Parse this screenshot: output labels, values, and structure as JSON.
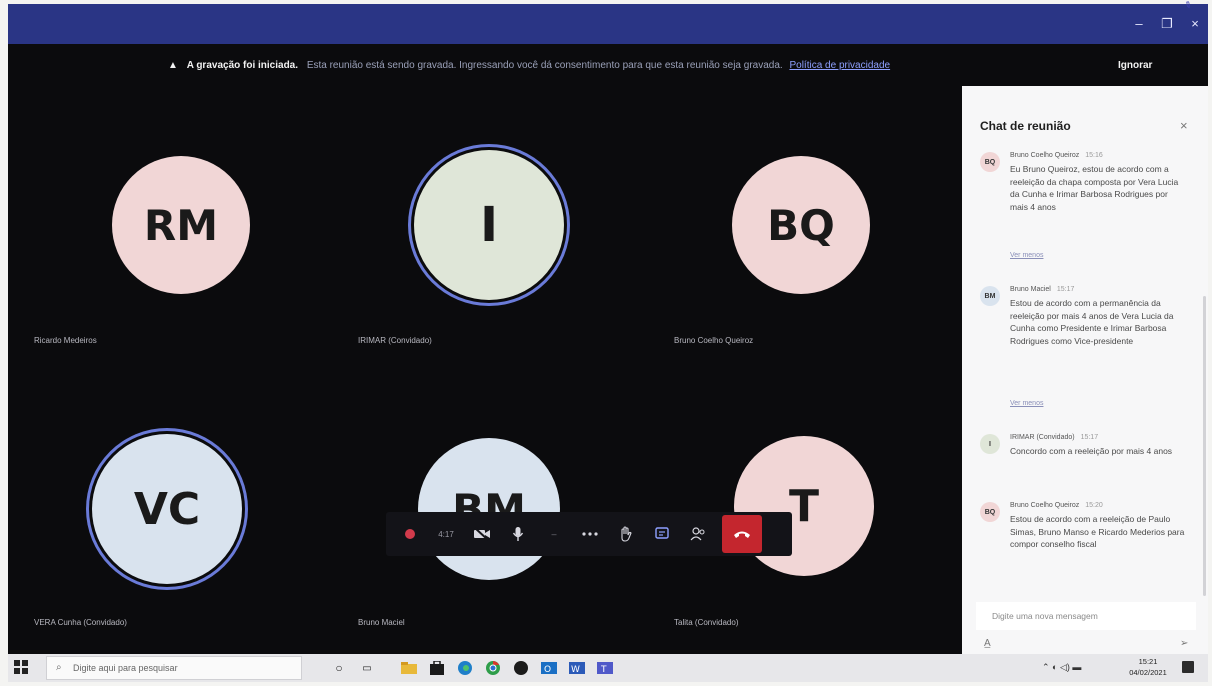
{
  "window": {
    "minimize_label": "–",
    "restore_label": "❐",
    "close_label": "×"
  },
  "banner": {
    "warning_icon": "warning-icon",
    "title": "A gravação foi iniciada.",
    "text": "Esta reunião está sendo gravada. Ingressando você dá consentimento para que esta reunião seja gravada.",
    "privacy_link": "Política de privacidade",
    "dismiss_label": "Ignorar"
  },
  "participants": [
    {
      "initials": "RM",
      "name": "Ricardo Medeiros",
      "color": "#f1d6d6"
    },
    {
      "initials": "I",
      "name": "IRIMAR (Convidado)",
      "color": "#dfe6d8"
    },
    {
      "initials": "BQ",
      "name": "Bruno Coelho Queiroz",
      "color": "#f1d6d6"
    },
    {
      "initials": "VC",
      "name": "VERA Cunha (Convidado)",
      "color": "#d9e3ee"
    },
    {
      "initials": "BM",
      "name": "Bruno Maciel",
      "color": "#d9e3ee"
    },
    {
      "initials": "T",
      "name": "Talita (Convidado)",
      "color": "#f1d6d6"
    }
  ],
  "controls": {
    "timer": "4:17"
  },
  "chat": {
    "title": "Chat de reunião",
    "input_placeholder": "Digite uma nova mensagem",
    "messages": [
      {
        "initials": "BQ",
        "author": "Bruno Coelho Queiroz",
        "time": "15:16",
        "text": "Eu Bruno Queiroz, estou de acordo com a reeleição da chapa composta por Vera Lucia da Cunha e Irimar Barbosa Rodrigues por mais 4 anos",
        "more": "Ver menos"
      },
      {
        "initials": "BM",
        "author": "Bruno Maciel",
        "time": "15:17",
        "text": "Estou de acordo com a permanência da reeleição por mais 4 anos de Vera Lucia da Cunha como Presidente e Irimar Barbosa Rodrigues como Vice-presidente",
        "more": "Ver menos"
      },
      {
        "initials": "I",
        "author": "IRIMAR (Convidado)",
        "time": "15:17",
        "text": "Concordo com a reeleição por mais 4 anos",
        "more": ""
      },
      {
        "initials": "BQ",
        "author": "Bruno Coelho Queiroz",
        "time": "15:20",
        "text": "Estou de acordo com a reeleição de Paulo Simas, Bruno Manso e Ricardo Mederios para compor conselho fiscal",
        "more": ""
      }
    ]
  },
  "taskbar": {
    "search_placeholder": "Digite aqui para pesquisar",
    "time": "15:21",
    "date": "04/02/2021",
    "apps": [
      "cortana-icon",
      "task-view-icon",
      "file-explorer-icon",
      "store-icon",
      "edge-icon",
      "chrome-icon",
      "app-icon",
      "outlook-icon",
      "word-icon",
      "teams-icon"
    ]
  }
}
